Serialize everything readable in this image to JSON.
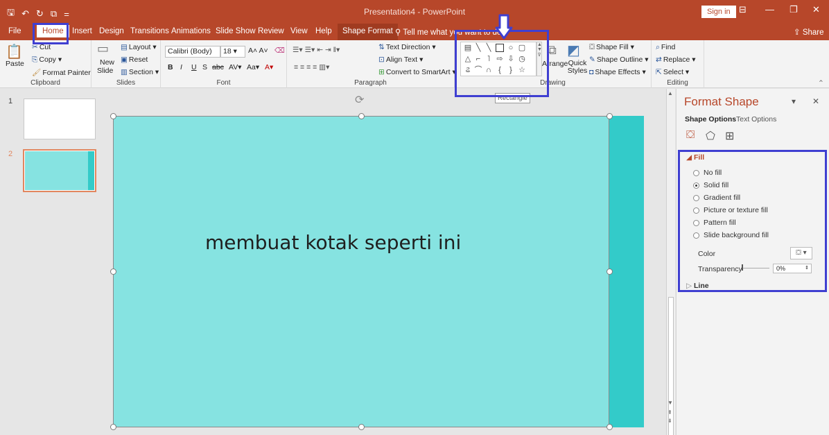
{
  "window": {
    "doc_title": "Presentation4 - PowerPoint",
    "sign_in": "Sign in",
    "minimize": "—",
    "restore": "❐",
    "close": "✕"
  },
  "qat": {
    "save": "🖫",
    "undo": "↶",
    "redo": "↻",
    "present": "⧉",
    "more": "="
  },
  "tabs": {
    "file": "File",
    "home": "Home",
    "insert": "Insert",
    "design": "Design",
    "transitions": "Transitions",
    "animations": "Animations",
    "slideshow": "Slide Show",
    "review": "Review",
    "view": "View",
    "help": "Help",
    "shape_format": "Shape Format",
    "tell_me": "Tell me what you want to do",
    "share": "Share"
  },
  "ribbon": {
    "clipboard": {
      "label": "Clipboard",
      "paste": "Paste",
      "cut": "Cut",
      "copy": "Copy",
      "format_painter": "Format Painter"
    },
    "slides": {
      "label": "Slides",
      "new_slide": "New",
      "new_slide2": "Slide",
      "layout": "Layout",
      "reset": "Reset",
      "section": "Section"
    },
    "font": {
      "label": "Font",
      "font_name": "Calibri (Body)",
      "font_size": "18"
    },
    "paragraph": {
      "label": "Paragraph",
      "text_direction": "Text Direction",
      "align_text": "Align Text",
      "convert_smartart": "Convert to SmartArt"
    },
    "drawing": {
      "label": "Drawing",
      "arrange": "Arrange",
      "quick_styles": "Quick Styles",
      "shape_fill": "Shape Fill",
      "shape_outline": "Shape Outline",
      "shape_effects": "Shape Effects"
    },
    "editing": {
      "label": "Editing",
      "find": "Find",
      "replace": "Replace",
      "select": "Select"
    },
    "tooltip": "Rectangle"
  },
  "slides_panel": {
    "slide1_num": "1",
    "slide2_num": "2"
  },
  "slide": {
    "text": "membuat kotak seperti ini",
    "fill_color": "#86e3e1",
    "strip_color": "#33cbc9"
  },
  "format_pane": {
    "title": "Format Shape",
    "tab_shape_options": "Shape Options",
    "tab_text_options": "Text Options",
    "fill_header": "Fill",
    "options": [
      "No fill",
      "Solid fill",
      "Gradient fill",
      "Picture or texture fill",
      "Pattern fill",
      "Slide background fill"
    ],
    "selected_option": "Solid fill",
    "color_label": "Color",
    "transparency_label": "Transparency",
    "transparency_value": "0%",
    "line_header": "Line"
  },
  "colors": {
    "accent": "#b7472a",
    "highlight": "#3f3fd1"
  }
}
